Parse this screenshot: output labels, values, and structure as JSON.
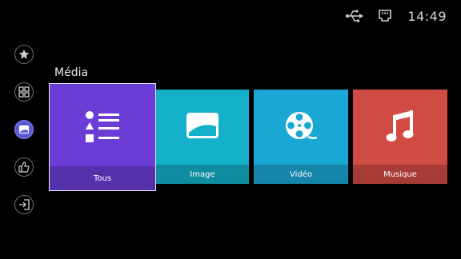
{
  "status_bar": {
    "clock": "14:49",
    "icons": [
      "usb-icon",
      "network-icon"
    ]
  },
  "sidebar": {
    "items": [
      {
        "name": "favorites",
        "icon": "star-icon",
        "active": false
      },
      {
        "name": "apps",
        "icon": "apps-grid-icon",
        "active": false
      },
      {
        "name": "media",
        "icon": "image-icon",
        "active": true
      },
      {
        "name": "recommended",
        "icon": "thumbs-up-icon",
        "active": false
      },
      {
        "name": "inputs",
        "icon": "input-source-icon",
        "active": false
      }
    ]
  },
  "main": {
    "section_title": "Média",
    "tiles": [
      {
        "label": "Tous",
        "icon": "list-icon",
        "color": "#6a3ed6",
        "focused": true
      },
      {
        "label": "Image",
        "icon": "picture-icon",
        "color": "#14b0c9",
        "focused": false
      },
      {
        "label": "Vidéo",
        "icon": "film-reel-icon",
        "color": "#1ba7d4",
        "focused": false
      },
      {
        "label": "Musique",
        "icon": "music-note-icon",
        "color": "#d04b43",
        "focused": false
      }
    ]
  },
  "colors": {
    "background": "#000000",
    "active_accent": "#5b5ad6"
  }
}
